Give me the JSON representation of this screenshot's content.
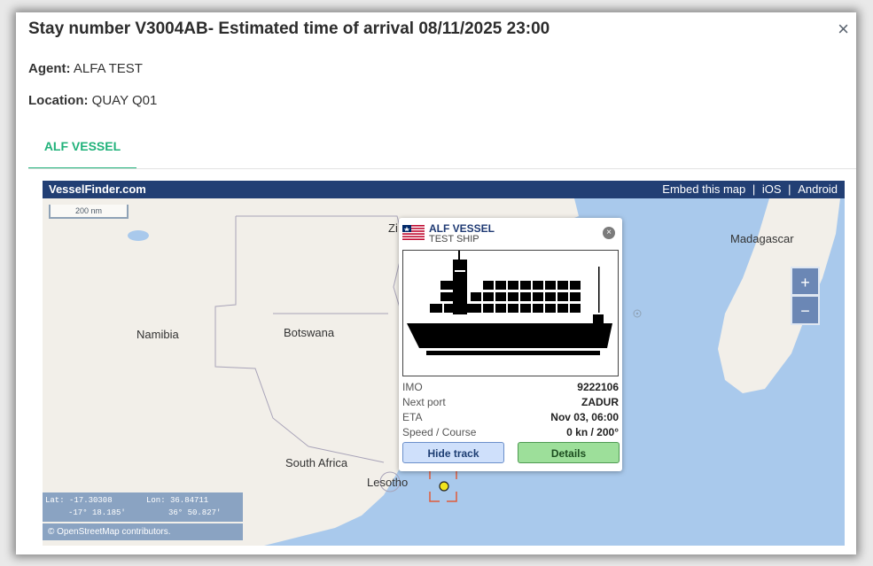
{
  "modal": {
    "title": "Stay number V3004AB- Estimated time of arrival 08/11/2025 23:00",
    "close_icon": "×",
    "agent_label": "Agent:",
    "agent_value": "ALFA TEST",
    "location_label": "Location:",
    "location_value": "QUAY Q01",
    "tab_label": "ALF VESSEL"
  },
  "map": {
    "brand": "VesselFinder.com",
    "links": [
      "Embed this map",
      "iOS",
      "Android"
    ],
    "link_separator": "|",
    "scale": "200 nm",
    "labels": {
      "namibia": "Namibia",
      "botswana": "Botswana",
      "south_africa": "South Africa",
      "lesotho": "Lesotho",
      "madagascar": "Madagascar",
      "zi": "Zi"
    },
    "zoom_in": "+",
    "zoom_out": "−",
    "coords": {
      "lat_label": "Lat: -17.30308",
      "lon_label": "Lon: 36.84711",
      "lat_dms": "-17° 18.185′",
      "lon_dms": "36° 50.827′"
    },
    "attribution": "© OpenStreetMap contributors."
  },
  "popup": {
    "vessel_name": "ALF VESSEL",
    "vessel_type": "TEST SHIP",
    "close_icon": "×",
    "rows": [
      {
        "key": "IMO",
        "value": "9222106"
      },
      {
        "key": "Next port",
        "value": "ZADUR"
      },
      {
        "key": "ETA",
        "value": "Nov 03, 06:00"
      },
      {
        "key": "Speed / Course",
        "value": "0 kn / 200°"
      }
    ],
    "hide_track": "Hide track",
    "details": "Details"
  },
  "colors": {
    "accent_green": "#20b27a",
    "header_navy": "#223f74",
    "sea": "#a9c9ec",
    "land": "#f2efe9"
  },
  "icons": [
    "close-icon",
    "liberia-flag-icon",
    "vessel-marker-icon",
    "container-ship-icon",
    "zoom-in-icon",
    "zoom-out-icon"
  ]
}
